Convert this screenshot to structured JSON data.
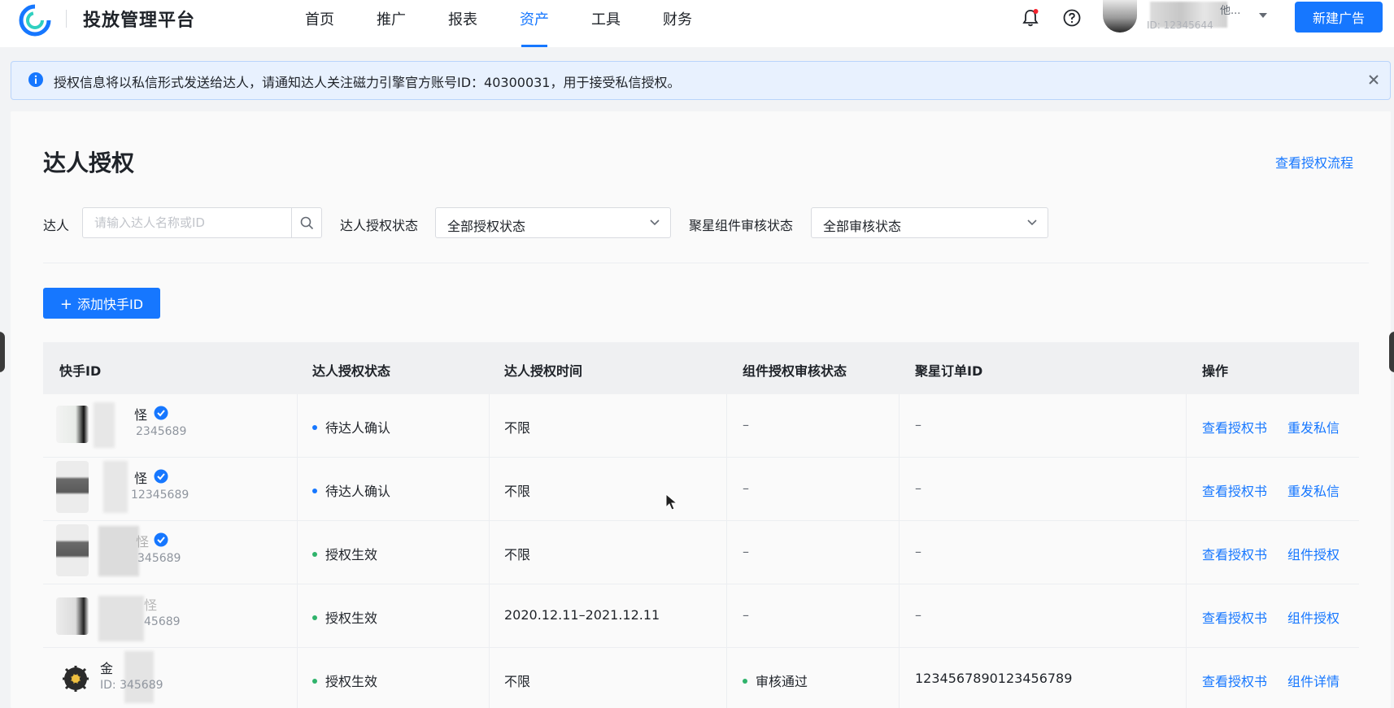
{
  "header": {
    "brand": "投放管理平台",
    "nav": [
      "首页",
      "推广",
      "报表",
      "资产",
      "工具",
      "财务"
    ],
    "active_nav": "资产",
    "account_name": "他...",
    "account_id": "ID: 12345644",
    "new_ad_label": "新建广告",
    "icons": [
      "logo-icon",
      "bell-icon",
      "help-icon",
      "avatar",
      "chevron-down-icon"
    ]
  },
  "notice": {
    "text": "授权信息将以私信形式发送给达人，请通知达人关注磁力引擎官方账号ID：40300031，用于接受私信授权。"
  },
  "page": {
    "title": "达人授权",
    "view_flow_link": "查看授权流程"
  },
  "filters": {
    "talent_label": "达人",
    "talent_placeholder": "请输入达人名称或ID",
    "auth_status_label": "达人授权状态",
    "auth_status_value": "全部授权状态",
    "review_status_label": "聚星组件审核状态",
    "review_status_value": "全部审核状态"
  },
  "add_button": {
    "plus": "+",
    "label": "添加快手ID"
  },
  "table": {
    "headers": [
      "快手ID",
      "达人授权状态",
      "达人授权时间",
      "组件授权审核状态",
      "聚星订单ID",
      "操作"
    ],
    "rows": [
      {
        "name": "怪",
        "id": "2345689",
        "auth_status": "待达人确认",
        "status_color": "blue",
        "auth_time": "不限",
        "review_status": "–",
        "order_id": "–",
        "op1": "查看授权书",
        "op2": "重发私信"
      },
      {
        "name": "怪",
        "id": "12345689",
        "auth_status": "待达人确认",
        "status_color": "blue",
        "auth_time": "不限",
        "review_status": "–",
        "order_id": "–",
        "op1": "查看授权书",
        "op2": "重发私信"
      },
      {
        "name": "怪",
        "id": "345689",
        "auth_status": "授权生效",
        "status_color": "green",
        "auth_time": "不限",
        "review_status": "–",
        "order_id": "–",
        "op1": "查看授权书",
        "op2": "组件授权"
      },
      {
        "name": "怪",
        "id": "45689",
        "auth_status": "授权生效",
        "status_color": "green",
        "auth_time": "2020.12.11–2021.12.11",
        "review_status": "–",
        "order_id": "–",
        "op1": "查看授权书",
        "op2": "组件授权"
      },
      {
        "name": "金",
        "id": "ID: 345689",
        "auth_status": "授权生效",
        "status_color": "green",
        "auth_time": "不限",
        "review_status": "审核通过",
        "order_id": "1234567890123456789",
        "op1": "查看授权书",
        "op2": "组件详情"
      }
    ]
  },
  "colors": {
    "accent": "#1677ff",
    "pending_dot": "#1677ff",
    "effective_dot": "#2fb36b",
    "notice_bg": "#e8f1fe"
  }
}
